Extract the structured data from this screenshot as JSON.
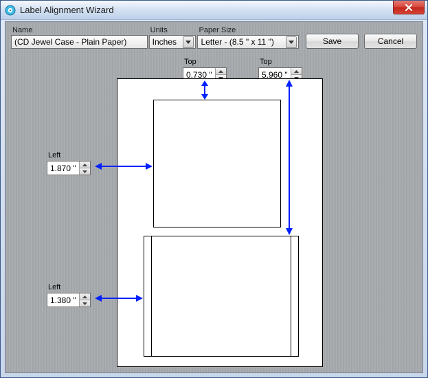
{
  "window": {
    "title": "Label Alignment Wizard"
  },
  "toolbar": {
    "name_label": "Name",
    "name_value": "(CD Jewel Case - Plain Paper)",
    "units_label": "Units",
    "units_value": "Inches",
    "paper_label": "Paper Size",
    "paper_value": "Letter - (8.5 \" x 11 \")",
    "save_label": "Save",
    "cancel_label": "Cancel"
  },
  "fields": {
    "top1_label": "Top",
    "top1_value": "0.730 \"",
    "top2_label": "Top",
    "top2_value": "5.960 \"",
    "left1_label": "Left",
    "left1_value": "1.870 \"",
    "left2_label": "Left",
    "left2_value": "1.380 \""
  }
}
